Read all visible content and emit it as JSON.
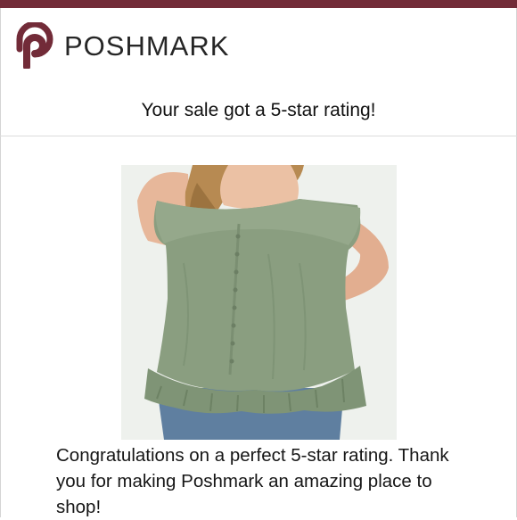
{
  "brand": {
    "name": "POSHMARK",
    "logo_icon": "poshmark-p-icon",
    "color": "#722b38"
  },
  "notification": {
    "headline": "Your sale got a 5-star rating!",
    "message": "Congratulations on a perfect 5-star rating. Thank you for making Poshmark an amazing place to shop!"
  },
  "product_image": {
    "icon": "off-shoulder-olive-ruffle-top-photo",
    "color": "#8a9e80"
  }
}
